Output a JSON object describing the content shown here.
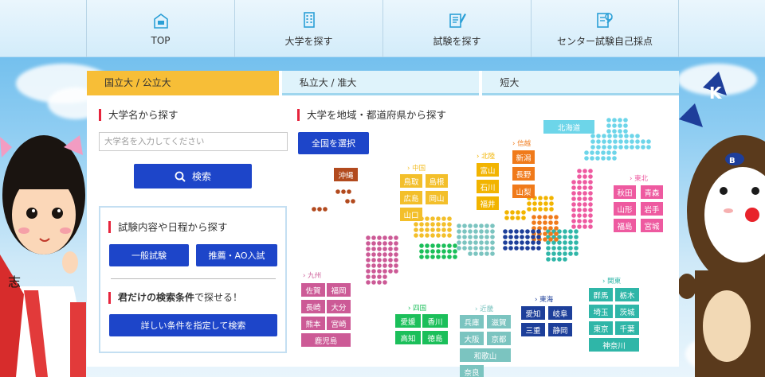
{
  "nav": [
    {
      "label": "TOP",
      "icon": "home-icon"
    },
    {
      "label": "大学を探す",
      "icon": "building-icon"
    },
    {
      "label": "試験を探す",
      "icon": "exam-pencil-icon"
    },
    {
      "label": "センター試験自己採点",
      "icon": "self-grading-icon"
    }
  ],
  "tabs": [
    "国立大 / 公立大",
    "私立大 / 准大",
    "短大"
  ],
  "name_search": {
    "title": "大学名から探す",
    "placeholder": "大学名を入力してください",
    "button": "検索"
  },
  "exam_search": {
    "title": "試験内容や日程から探す",
    "buttons": [
      "一般試験",
      "推薦・AO入試"
    ],
    "promo_bold": "君だけの検索条件",
    "promo_rest": "で探せる！",
    "detail_button": "詳しい条件を指定して検索"
  },
  "map": {
    "title": "大学を地域・都道府県から探す",
    "select_all": "全国を選択",
    "regions": {
      "hokkaido": {
        "label": "北海道",
        "color": "#6dd5e9"
      },
      "tohoku": {
        "label": "東北",
        "color": "#ee5aa0"
      },
      "kanto": {
        "label": "関東",
        "color": "#2fb6a8"
      },
      "hokuriku": {
        "label": "北陸",
        "color": "#f2b400"
      },
      "shinetsu": {
        "label": "信越",
        "color": "#f07a1a"
      },
      "tokai": {
        "label": "東海",
        "color": "#1d3f9a"
      },
      "kinki": {
        "label": "近畿",
        "color": "#7bc4c0"
      },
      "chugoku": {
        "label": "中国",
        "color": "#f3bf2a"
      },
      "shikoku": {
        "label": "四国",
        "color": "#1bbf5a"
      },
      "kyushu": {
        "label": "九州",
        "color": "#cc5a96"
      },
      "okinawa": {
        "label": "沖縄",
        "color": "#b24a1e"
      }
    },
    "prefs": {
      "okinawa": [
        "沖縄"
      ],
      "chugoku": [
        "鳥取",
        "島根",
        "広島",
        "岡山",
        "山口"
      ],
      "hokuriku": [
        "富山",
        "石川",
        "福井"
      ],
      "shinetsu": [
        "新潟",
        "長野",
        "山梨"
      ],
      "tohoku": [
        "秋田",
        "青森",
        "山形",
        "岩手",
        "福島",
        "宮城"
      ],
      "kyushu": [
        "佐賀",
        "福岡",
        "長崎",
        "大分",
        "熊本",
        "宮崎",
        "鹿児島"
      ],
      "shikoku": [
        "愛媛",
        "香川",
        "高知",
        "徳島"
      ],
      "kinki": [
        "兵庫",
        "滋賀",
        "大阪",
        "京都",
        "和歌山",
        "奈良"
      ],
      "tokai": [
        "愛知",
        "岐阜",
        "三重",
        "静岡"
      ],
      "kanto": [
        "群馬",
        "栃木",
        "埼玉",
        "茨城",
        "東京",
        "千葉",
        "神奈川"
      ]
    }
  }
}
